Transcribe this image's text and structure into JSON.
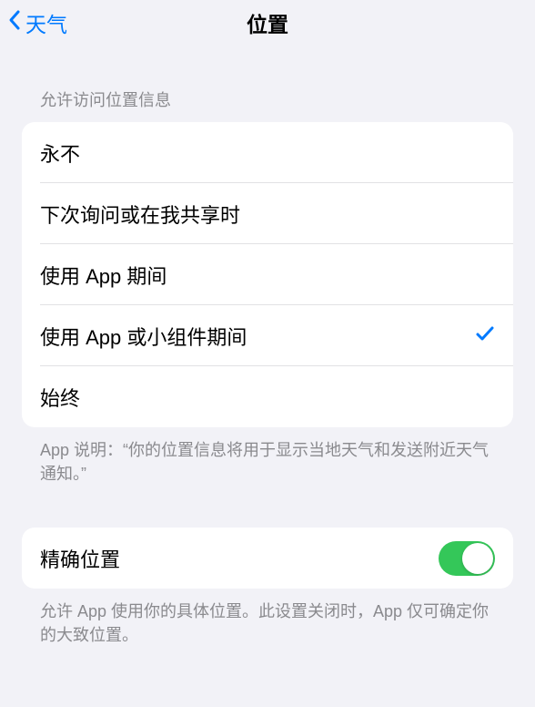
{
  "nav": {
    "back_label": "天气",
    "title": "位置"
  },
  "location_access": {
    "header": "允许访问位置信息",
    "options": [
      {
        "label": "永不",
        "selected": false
      },
      {
        "label": "下次询问或在我共享时",
        "selected": false
      },
      {
        "label": "使用 App 期间",
        "selected": false
      },
      {
        "label": "使用 App 或小组件期间",
        "selected": true
      },
      {
        "label": "始终",
        "selected": false
      }
    ],
    "footer": "App 说明：“你的位置信息将用于显示当地天气和发送附近天气通知。”"
  },
  "precise": {
    "label": "精确位置",
    "enabled": true,
    "footer": "允许 App 使用你的具体位置。此设置关闭时，App 仅可确定你的大致位置。"
  }
}
